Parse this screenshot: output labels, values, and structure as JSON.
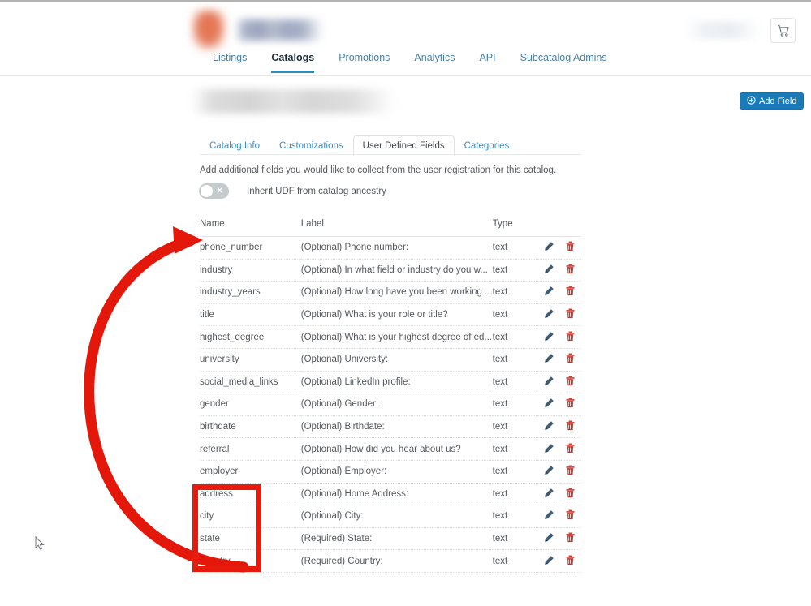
{
  "header": {
    "brand_mark": "logo-mark",
    "brand_wordmark": "logo-wordmark",
    "cart_icon": "shopping-cart-icon",
    "nav": [
      {
        "label": "Listings",
        "active": false
      },
      {
        "label": "Catalogs",
        "active": true
      },
      {
        "label": "Promotions",
        "active": false
      },
      {
        "label": "Analytics",
        "active": false
      },
      {
        "label": "API",
        "active": false
      },
      {
        "label": "Subcatalog Admins",
        "active": false
      }
    ]
  },
  "page": {
    "title_redacted": "",
    "add_field_label": "Add Field",
    "add_field_icon": "plus-circle-icon"
  },
  "sub_tabs": [
    {
      "label": "Catalog Info",
      "active": false
    },
    {
      "label": "Customizations",
      "active": false
    },
    {
      "label": "User Defined Fields",
      "active": true
    },
    {
      "label": "Categories",
      "active": false
    }
  ],
  "udf": {
    "description": "Add additional fields you would like to collect from the user registration for this catalog.",
    "inherit_toggle": {
      "label": "Inherit UDF from catalog ancestry",
      "state": "off",
      "off_glyph": "✕"
    },
    "columns": [
      "Name",
      "Label",
      "Type"
    ],
    "edit_icon": "pencil-icon",
    "delete_icon": "trash-icon",
    "rows": [
      {
        "name": "phone_number",
        "label": "(Optional) Phone number:",
        "type": "text"
      },
      {
        "name": "industry",
        "label": "(Optional) In what field or industry do you w...",
        "type": "text"
      },
      {
        "name": "industry_years",
        "label": "(Optional) How long have you been working ...",
        "type": "text"
      },
      {
        "name": "title",
        "label": "(Optional) What is your role or title?",
        "type": "text"
      },
      {
        "name": "highest_degree",
        "label": "(Optional) What is your highest degree of ed...",
        "type": "text"
      },
      {
        "name": "university",
        "label": "(Optional) University:",
        "type": "text"
      },
      {
        "name": "social_media_links",
        "label": "(Optional) LinkedIn profile:",
        "type": "text"
      },
      {
        "name": "gender",
        "label": "(Optional) Gender:",
        "type": "text"
      },
      {
        "name": "birthdate",
        "label": "(Optional) Birthdate:",
        "type": "text"
      },
      {
        "name": "referral",
        "label": "(Optional) How did you hear about us?",
        "type": "text"
      },
      {
        "name": "employer",
        "label": "(Optional) Employer:",
        "type": "text"
      },
      {
        "name": "address",
        "label": "(Optional) Home Address:",
        "type": "text"
      },
      {
        "name": "city",
        "label": "(Optional) City:",
        "type": "text"
      },
      {
        "name": "state",
        "label": "(Required) State:",
        "type": "text"
      },
      {
        "name": "country",
        "label": "(Required) Country:",
        "type": "text"
      }
    ]
  },
  "annotations": {
    "highlight_color": "#e81a0c",
    "arrow_color": "#e3170a",
    "highlighted_rows": [
      "address",
      "city",
      "state",
      "country"
    ]
  },
  "colors": {
    "accent_blue": "#1a7bb9",
    "link_blue": "#3b8dc4",
    "nav_underline": "#2b8cbe",
    "delete_red": "#cc342b",
    "edit_slate": "#3f5c73"
  }
}
